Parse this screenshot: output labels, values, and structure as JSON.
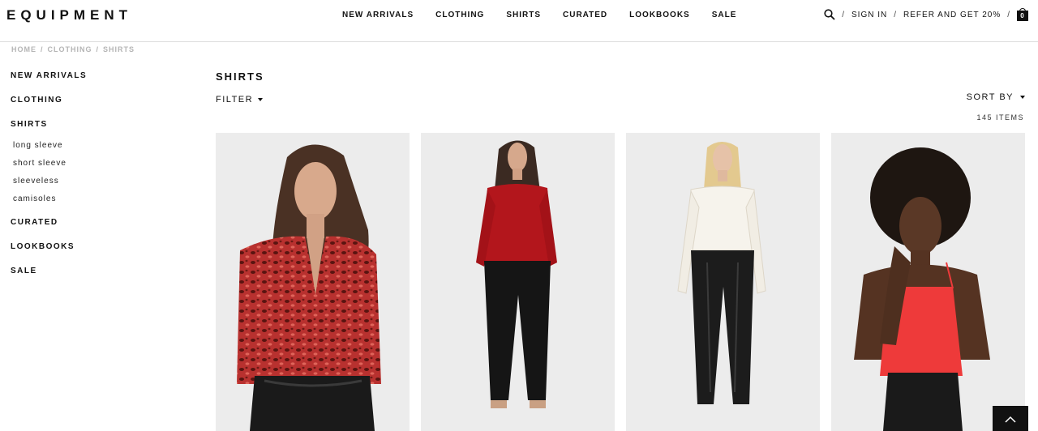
{
  "header": {
    "logo": "EQUIPMENT",
    "nav": [
      "NEW ARRIVALS",
      "CLOTHING",
      "SHIRTS",
      "CURATED",
      "LOOKBOOKS",
      "SALE"
    ],
    "sign_in": "SIGN IN",
    "refer": "REFER AND GET 20%",
    "bag_count": "0",
    "separator": "/"
  },
  "breadcrumb": [
    "HOME",
    "CLOTHING",
    "SHIRTS"
  ],
  "sidebar": {
    "items": [
      "NEW ARRIVALS",
      "CLOTHING",
      "SHIRTS"
    ],
    "sub_items": [
      "long sleeve",
      "short sleeve",
      "sleeveless",
      "camisoles"
    ],
    "items_after": [
      "CURATED",
      "LOOKBOOKS",
      "SALE"
    ]
  },
  "main": {
    "title": "SHIRTS",
    "filter_label": "FILTER",
    "sort_label": "SORT BY",
    "item_count": "145 ITEMS"
  },
  "products": [
    {
      "shirt_color": "#a42a2a",
      "pattern": "leopard",
      "bottom_color": "#1a1a1a"
    },
    {
      "shirt_color": "#b3161c",
      "pattern": "solid",
      "bottom_color": "#151515"
    },
    {
      "shirt_color": "#f6f3ec",
      "pattern": "solid",
      "bottom_color": "#1c1c1c"
    },
    {
      "shirt_color": "#ee3a3a",
      "pattern": "cami",
      "bottom_color": "#1a1a1a"
    }
  ],
  "colors": {
    "text": "#111111",
    "breadcrumb": "#b5b5b5",
    "tile_bg": "#ededed"
  }
}
